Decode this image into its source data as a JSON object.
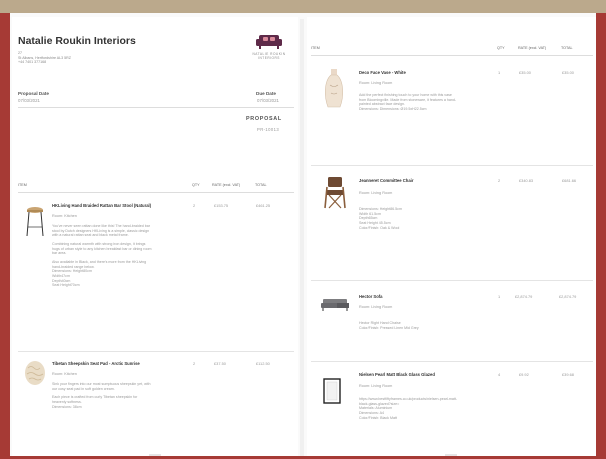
{
  "company": {
    "name": "Natalie Roukin Interiors",
    "address_lines": [
      "27",
      "St Albans, Hertfordshire AL3 5RZ",
      "+44 7401 377168"
    ],
    "logo_text_lines": [
      "NATALIE ROUKIN",
      "INTERIORS"
    ]
  },
  "proposal": {
    "date_label": "Proposal Date",
    "date_value": "07/03/2021",
    "due_label": "Due Date",
    "due_value": "07/03/2021",
    "title": "PROPOSAL",
    "number": "PR-10013"
  },
  "columns": {
    "item": "ITEM",
    "qty": "QTY",
    "rate": "RATE (excl. VAT)",
    "total": "TOTAL"
  },
  "left_items": [
    {
      "name": "HKLiving Hand Braided Rattan Bar Stool (Natural)",
      "room": "Room: Kitchen",
      "qty": "2",
      "rate": "£153.75",
      "total": "£461.25",
      "desc": [
        "You've never seen rattan done like this! The hand-braided bar\nstool by Dutch designers HKLiving is a simple, classic design\nwith a natural rattan seat and black metal frame.",
        "Combining natural warmth with strong iron design, it brings\nhugs of urban style to any kitchen breakfast bar or dining room\nbar area.",
        "Also available in Black, and there's more from the HKLiving\nhand-braided range below.\nDimensions: Height80cm\nWidth47cm\nDepth40cm\nSeat Height70cm"
      ]
    },
    {
      "name": "Tibetan Sheepskin Seat Pad - Arctic Sunrise",
      "room": "Room: Kitchen",
      "qty": "2",
      "rate": "£37.50",
      "total": "£112.50",
      "desc": [
        "Sink your fingers into our most sumptuous sheepskin yet, with\nour cosy seat pad in soft golden cream.",
        "Each piece is crafted from curly Tibetan sheepskin for\nheavenly softness.\nDimensions: 38cm"
      ]
    }
  ],
  "right_items": [
    {
      "name": "Deco Face Vase - White",
      "room": "Room: Living Room",
      "qty": "1",
      "rate": "£35.00",
      "total": "£35.00",
      "desc": [
        "Add the perfect finishing touch to your home with this vase\nfrom Bloomingville. Made from stoneware, it features a hand-\npainted abstract face design.\nDimensions: Dimensions: Ø19.5xH22.5cm"
      ]
    },
    {
      "name": "Jeanneret Committee Chair",
      "room": "Room: Living Room",
      "qty": "2",
      "rate": "£340.83",
      "total": "£681.66",
      "desc": [
        "Dimensions: Height86.5cm\nWidth 61.5cm\nDepth65cm\nSeat Height 45.5cm\nColor/Finish: Oak & Wool"
      ]
    },
    {
      "name": "Hector Sofa",
      "room": "Room: Living Room",
      "qty": "1",
      "rate": "£2,874.79",
      "total": "£2,874.79",
      "desc": [
        "Hector Right Hand Chaise\nColor/Finish: Pressed Linen Mid Grey"
      ]
    },
    {
      "name": "Nielsen Pearl Matt Black Glass Glazed",
      "room": "Room: Living Room",
      "qty": "4",
      "rate": "£9.92",
      "total": "£39.68",
      "desc": [
        "https://www.bestfiftyframes.co.uk/products/nielsen-pearl-matt-\nblack-glass-glazed?size=\nMaterials: Aluminium\nDimensions: A4\nColor/Finish: Black Matt"
      ]
    }
  ],
  "colors": {
    "frame": "#a63a35",
    "topbar": "#bba98c",
    "logo_sofa": "#5e2a49",
    "accent_pink": "#d98a9a"
  }
}
